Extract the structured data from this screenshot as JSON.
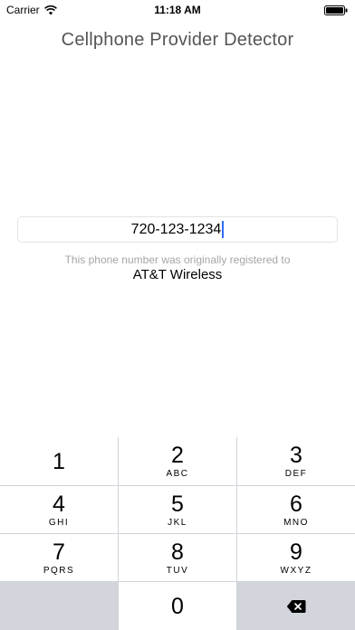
{
  "status_bar": {
    "carrier": "Carrier",
    "time": "11:18 AM"
  },
  "app": {
    "title": "Cellphone Provider Detector"
  },
  "phone": {
    "value": "720-123-1234"
  },
  "result": {
    "caption": "This phone number was originally registered to",
    "provider": "AT&T Wireless"
  },
  "keypad": {
    "keys": [
      {
        "digit": "1",
        "letters": ""
      },
      {
        "digit": "2",
        "letters": "ABC"
      },
      {
        "digit": "3",
        "letters": "DEF"
      },
      {
        "digit": "4",
        "letters": "GHI"
      },
      {
        "digit": "5",
        "letters": "JKL"
      },
      {
        "digit": "6",
        "letters": "MNO"
      },
      {
        "digit": "7",
        "letters": "PQRS"
      },
      {
        "digit": "8",
        "letters": "TUV"
      },
      {
        "digit": "9",
        "letters": "WXYZ"
      },
      {
        "digit": "0",
        "letters": ""
      }
    ],
    "backspace_icon": "backspace-icon"
  }
}
